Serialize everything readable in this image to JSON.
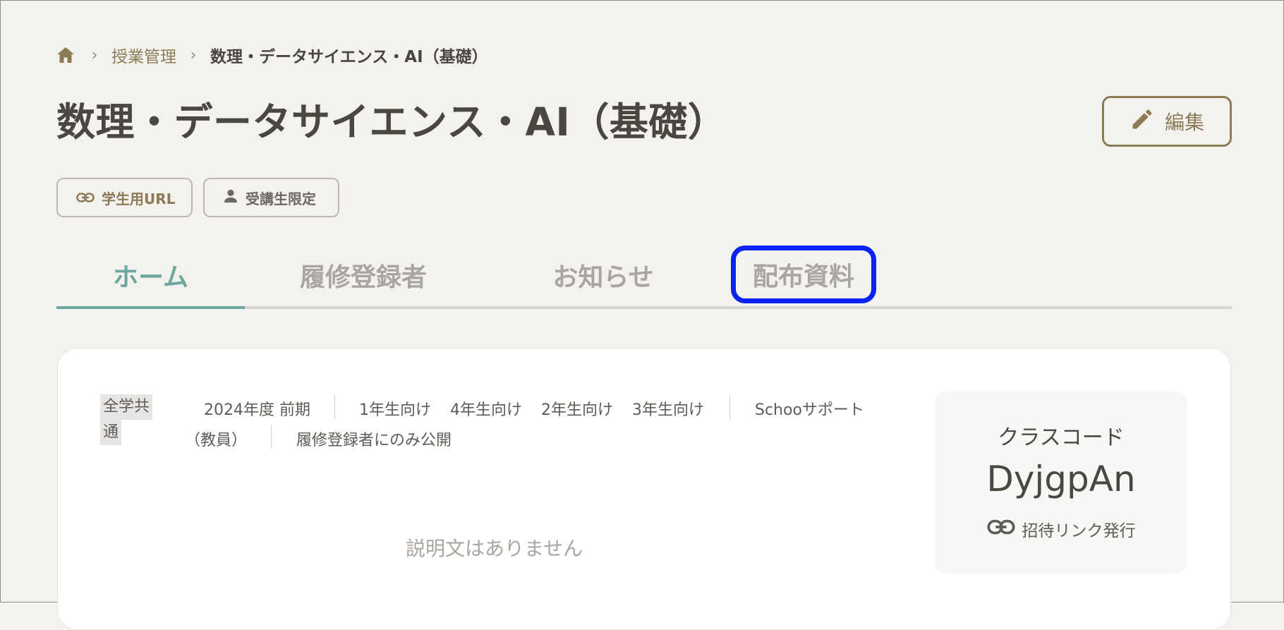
{
  "breadcrumb": {
    "home_icon": "home-icon",
    "items": [
      "授業管理",
      "数理・データサイエンス・AI（基礎）"
    ]
  },
  "page": {
    "title": "数理・データサイエンス・AI（基礎）",
    "edit_label": "編集"
  },
  "chips": {
    "student_url": "学生用URL",
    "students_only": "受講生限定"
  },
  "tabs": [
    "ホーム",
    "履修登録者",
    "お知らせ",
    "配布資料"
  ],
  "active_tab": "ホーム",
  "course_meta": {
    "tag_line1": "全学共",
    "tag_line2": "通",
    "term": "2024年度 前期",
    "grades": [
      "1年生向け",
      "4年生向け",
      "2年生向け",
      "3年生向け"
    ],
    "owner_line1": "Schooサポート",
    "owner_line2": "（教員）",
    "visibility": "履修登録者にのみ公開"
  },
  "description_empty": "説明文はありません",
  "class_code": {
    "label": "クラスコード",
    "value": "DyjgpAn",
    "invite_label": "招待リンク発行"
  },
  "colors": {
    "accent_brown": "#8d7b55",
    "active_teal": "#6fa7a0",
    "highlight_blue": "#0a23f2",
    "background": "#f3f2ef"
  }
}
